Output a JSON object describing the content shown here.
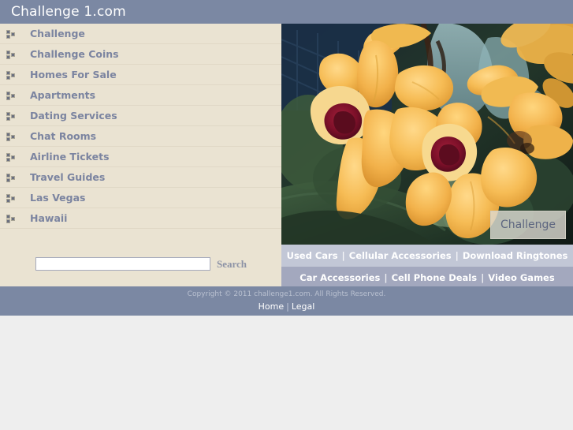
{
  "header": {
    "title": "Challenge 1.com",
    "background": "#7b88a3",
    "text_color": "#ffffff"
  },
  "sidebar": {
    "background": "#eae3d2",
    "link_color": "#7b84a0",
    "items": [
      {
        "label": "Challenge",
        "icon": "bullet-squares-icon"
      },
      {
        "label": "Challenge Coins",
        "icon": "bullet-squares-icon"
      },
      {
        "label": "Homes For Sale",
        "icon": "bullet-squares-icon"
      },
      {
        "label": "Apartments",
        "icon": "bullet-squares-icon"
      },
      {
        "label": "Dating Services",
        "icon": "bullet-squares-icon"
      },
      {
        "label": "Chat Rooms",
        "icon": "bullet-squares-icon"
      },
      {
        "label": "Airline Tickets",
        "icon": "bullet-squares-icon"
      },
      {
        "label": "Travel Guides",
        "icon": "bullet-squares-icon"
      },
      {
        "label": "Las Vegas",
        "icon": "bullet-squares-icon"
      },
      {
        "label": "Hawaii",
        "icon": "bullet-squares-icon"
      }
    ]
  },
  "search": {
    "value": "",
    "placeholder": "",
    "button_label": "Search"
  },
  "hero": {
    "alt": "yellow orchid flowers with dark red centers on green foliage",
    "badge_label": "Challenge"
  },
  "linkbars": [
    {
      "background": "#c2c7d6",
      "links": [
        "Used Cars",
        "Cellular Accessories",
        "Download Ringtones"
      ],
      "separator": "|"
    },
    {
      "background": "#a3a8be",
      "links": [
        "Car Accessories",
        "Cell Phone Deals",
        "Video Games"
      ],
      "separator": "|"
    }
  ],
  "footer": {
    "background": "#7b88a3",
    "copyright": "Copyright © 2011 challenge1.com. All Rights Reserved.",
    "links": [
      "Home",
      "Legal"
    ],
    "separator": "|"
  }
}
